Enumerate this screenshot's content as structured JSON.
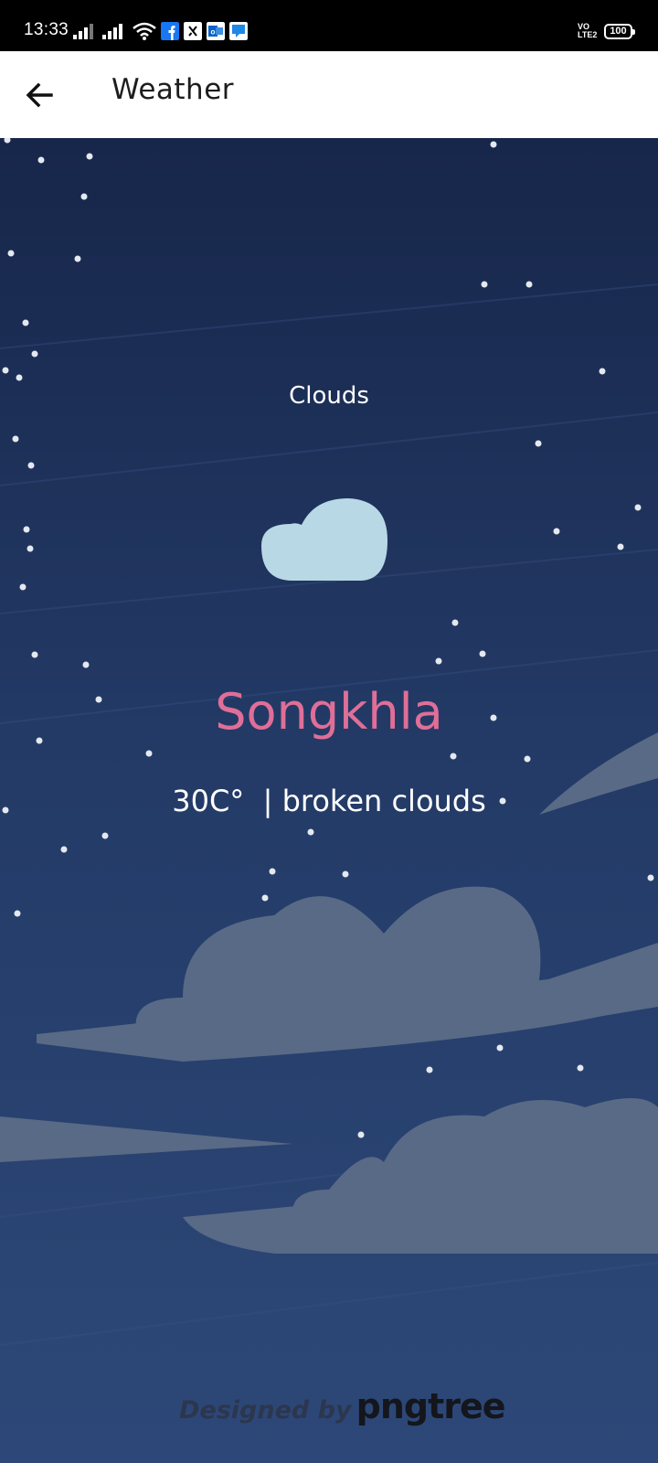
{
  "status_bar": {
    "time": "13:33",
    "network": "VO LTE2",
    "battery": "100",
    "icons": [
      "signal-icon",
      "signal-icon",
      "wifi-icon",
      "facebook-icon",
      "notification-icon",
      "outlook-icon",
      "message-icon"
    ]
  },
  "app_bar": {
    "title": "Weather",
    "back_icon": "arrow-left-icon"
  },
  "weather": {
    "condition": "Clouds",
    "icon": "cloud-icon",
    "city": "Songkhla",
    "summary": "30C°  | broken clouds"
  },
  "watermark": {
    "prefix": "Designed by",
    "brand": "pngtree"
  },
  "colors": {
    "sky_top": "#17264a",
    "sky_bottom": "#2e4a7c",
    "cloud_icon": "#b8d8e6",
    "city_text": "#df6f98"
  }
}
